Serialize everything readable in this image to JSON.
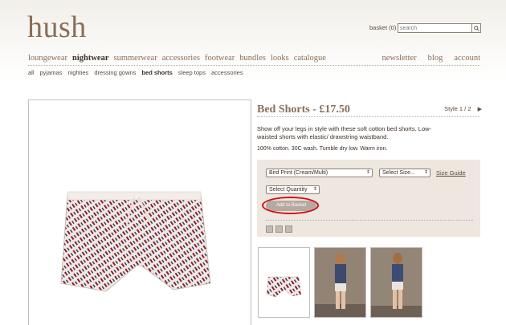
{
  "header": {
    "logo": "hush",
    "basket": "basket (0)",
    "search_placeholder": "search"
  },
  "nav": {
    "left": [
      "loungewear",
      "nightwear",
      "summerwear",
      "accessories",
      "footwear",
      "bundles",
      "looks",
      "catalogue"
    ],
    "active": "nightwear",
    "right": [
      "newsletter",
      "blog",
      "account"
    ]
  },
  "subnav": {
    "items": [
      "all",
      "pyjamas",
      "nighties",
      "dressing gowns",
      "bed shorts",
      "sleep tops",
      "accessories"
    ],
    "active": "bed shorts"
  },
  "product": {
    "title": "Bed Shorts - £17.50",
    "style": "Style 1 / 2",
    "description": "Show off your legs in style with these soft cotton bed shorts. Low-waisted shorts with elastic/ drawstring waistband.",
    "care": "100% cotton. 30C wash. Tumble dry low. Warm iron.",
    "colour_select": "Bird Print (Cream/Multi)",
    "size_select": "Select Size...",
    "size_guide": "Size Guide",
    "quantity_select": "Select Quantity",
    "add_button": "Add to Basket"
  },
  "colors": {
    "accent": "#8a6e57",
    "highlight": "#d40e0e",
    "panel": "#ede7e0"
  }
}
